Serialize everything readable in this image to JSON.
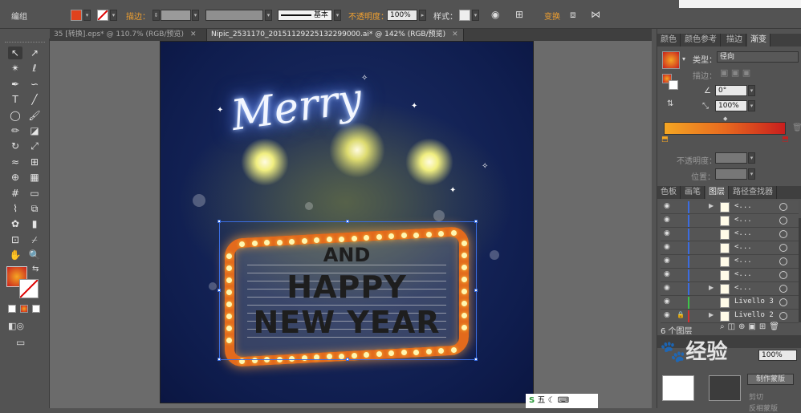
{
  "control_bar": {
    "mode_label": "编组",
    "stroke_label": "描边：",
    "stroke_style": "基本",
    "opacity_label": "不透明度：",
    "opacity_value": "100%",
    "style_label": "样式：",
    "transform_label": "变换",
    "fill_color": "#e0421c",
    "accent": "#f0a030"
  },
  "doc_tabs": [
    {
      "label": "35 [转换].eps* @ 110.7% (RGB/预览)",
      "active": false
    },
    {
      "label": "Nipic_2531170_20151129225132299000.ai* @ 142% (RGB/预览)",
      "active": true
    }
  ],
  "tools": [
    {
      "name": "selection-tool",
      "glyph": "↖"
    },
    {
      "name": "direct-selection-tool",
      "glyph": "↗"
    },
    {
      "name": "magic-wand-tool",
      "glyph": "✴"
    },
    {
      "name": "lasso-tool",
      "glyph": "ℓ"
    },
    {
      "name": "pen-tool",
      "glyph": "✒"
    },
    {
      "name": "curvature-tool",
      "glyph": "∽"
    },
    {
      "name": "type-tool",
      "glyph": "T"
    },
    {
      "name": "line-tool",
      "glyph": "╱"
    },
    {
      "name": "ellipse-tool",
      "glyph": "◯"
    },
    {
      "name": "paintbrush-tool",
      "glyph": "🖌"
    },
    {
      "name": "pencil-tool",
      "glyph": "✏"
    },
    {
      "name": "eraser-tool",
      "glyph": "◪"
    },
    {
      "name": "rotate-tool",
      "glyph": "↻"
    },
    {
      "name": "scale-tool",
      "glyph": "⤢"
    },
    {
      "name": "warp-tool",
      "glyph": "≈"
    },
    {
      "name": "free-transform-tool",
      "glyph": "⊞"
    },
    {
      "name": "shape-builder-tool",
      "glyph": "⊕"
    },
    {
      "name": "perspective-tool",
      "glyph": "▦"
    },
    {
      "name": "mesh-tool",
      "glyph": "#"
    },
    {
      "name": "gradient-tool",
      "glyph": "▭"
    },
    {
      "name": "eyedropper-tool",
      "glyph": "⌇"
    },
    {
      "name": "blend-tool",
      "glyph": "⧉"
    },
    {
      "name": "symbol-sprayer-tool",
      "glyph": "✿"
    },
    {
      "name": "graph-tool",
      "glyph": "▮"
    },
    {
      "name": "artboard-tool",
      "glyph": "⊡"
    },
    {
      "name": "slice-tool",
      "glyph": "⌿"
    },
    {
      "name": "hand-tool",
      "glyph": "✋"
    },
    {
      "name": "zoom-tool",
      "glyph": "🔍"
    }
  ],
  "artwork": {
    "merry": "Merry",
    "and": "AND",
    "happy": "HAPPY",
    "new_year": "NEW YEAR"
  },
  "panel_tabs_top": [
    "颜色",
    "颜色参考",
    "描边",
    "渐变"
  ],
  "gradient_panel": {
    "type_label": "类型：",
    "type_value": "径向",
    "stroke_label": "描边：",
    "angle_value": "0°",
    "aspect_value": "100%",
    "opacity_label": "不透明度：",
    "location_label": "位置：",
    "start_color": "#f5a623",
    "end_color": "#c81e1e"
  },
  "panel_tabs_layers": [
    "色板",
    "画笔",
    "图层",
    "路径查找器"
  ],
  "layers": [
    {
      "name": "<...",
      "bar": "#3b6ce0",
      "expand": true
    },
    {
      "name": "<...",
      "bar": "#3b6ce0",
      "expand": false
    },
    {
      "name": "<...",
      "bar": "#3b6ce0",
      "expand": false
    },
    {
      "name": "<...",
      "bar": "#3b6ce0",
      "expand": false
    },
    {
      "name": "<...",
      "bar": "#3b6ce0",
      "expand": false
    },
    {
      "name": "<...",
      "bar": "#3b6ce0",
      "expand": false
    },
    {
      "name": "<...",
      "bar": "#3b6ce0",
      "expand": true
    },
    {
      "name": "Livello 3",
      "bar": "#3ec44a",
      "expand": false
    },
    {
      "name": "Livello 2",
      "bar": "#d33030",
      "expand": true
    }
  ],
  "layers_footer": {
    "count": "6 个图层"
  },
  "transparency_value": "100%",
  "bottom_panel": {
    "make_mask": "制作蒙版",
    "clip": "剪切",
    "invert": "反相蒙版"
  },
  "taskbar": {
    "ime": "五"
  },
  "watermark": "经验"
}
